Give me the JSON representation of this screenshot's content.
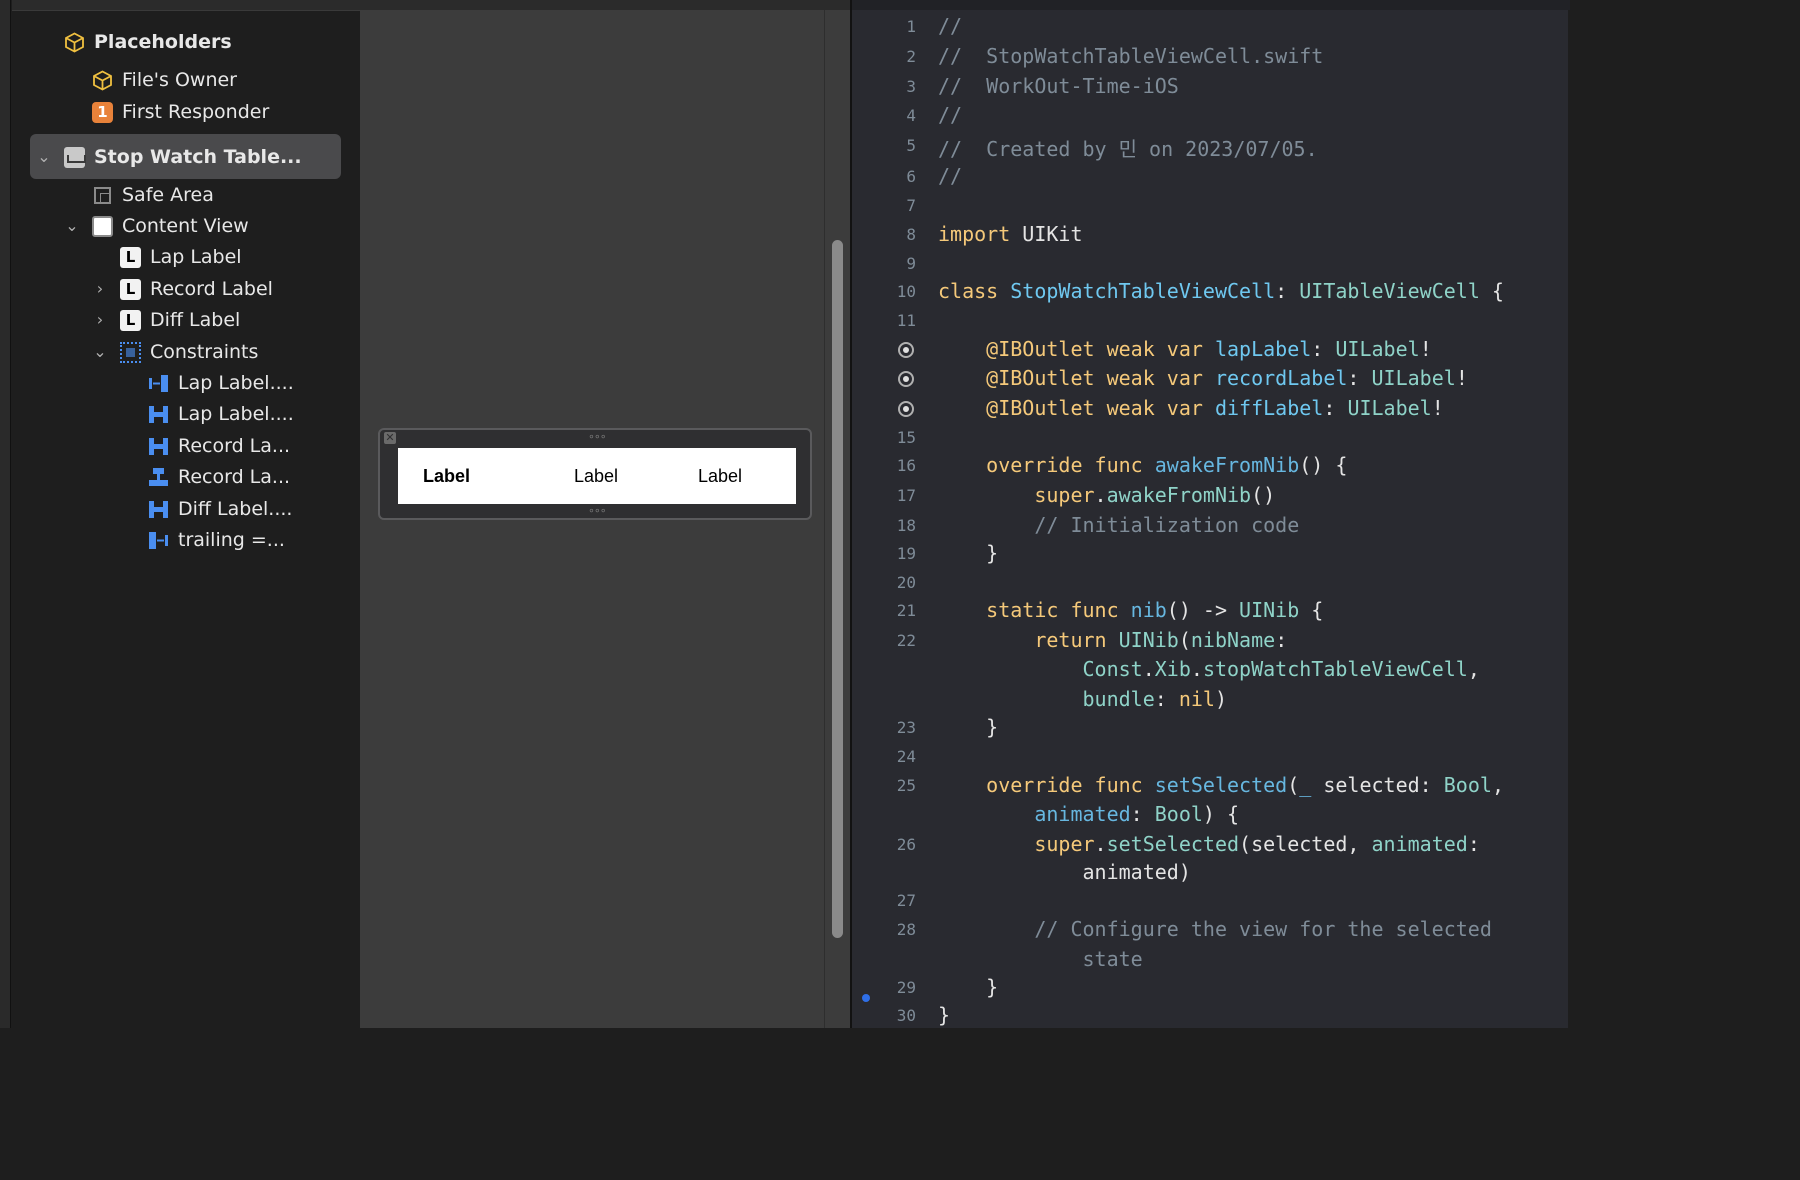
{
  "outline": {
    "placeholders": "Placeholders",
    "files_owner": "File's Owner",
    "first_responder_badge": "1",
    "first_responder": "First Responder",
    "cell": "Stop Watch Table...",
    "safe_area": "Safe Area",
    "content_view": "Content View",
    "lap_label": "Lap Label",
    "record_label": "Record Label",
    "diff_label": "Diff Label",
    "constraints": "Constraints",
    "constraint_items": [
      "Lap Label....",
      "Lap Label....",
      "Record La...",
      "Record La...",
      "Diff Label....",
      "trailing =..."
    ],
    "label_icon_letter": "L"
  },
  "canvas": {
    "labels": [
      "Label",
      "Label",
      "Label"
    ]
  },
  "editor": {
    "line_numbers": [
      "1",
      "2",
      "3",
      "4",
      "5",
      "6",
      "7",
      "8",
      "9",
      "10",
      "11",
      "",
      "",
      "",
      "15",
      "16",
      "17",
      "18",
      "19",
      "20",
      "21",
      "22",
      "",
      "",
      "23",
      "24",
      "25",
      "",
      "26",
      "",
      "27",
      "28",
      "",
      "29",
      "30"
    ],
    "lines": [
      {
        "n": "1",
        "parts": [
          {
            "t": "//",
            "c": "comment"
          }
        ]
      },
      {
        "n": "2",
        "parts": [
          {
            "t": "//  StopWatchTableViewCell.swift",
            "c": "comment"
          }
        ]
      },
      {
        "n": "3",
        "parts": [
          {
            "t": "//  WorkOut-Time-iOS",
            "c": "comment"
          }
        ]
      },
      {
        "n": "4",
        "parts": [
          {
            "t": "//",
            "c": "comment"
          }
        ]
      },
      {
        "n": "5",
        "parts": [
          {
            "t": "//  Created by 민 on 2023/07/05.",
            "c": "comment"
          }
        ]
      },
      {
        "n": "6",
        "parts": [
          {
            "t": "//",
            "c": "comment"
          }
        ]
      },
      {
        "n": "7",
        "parts": []
      },
      {
        "n": "8",
        "parts": [
          {
            "t": "import",
            "c": "kw"
          },
          {
            "t": " UIKit",
            "c": "plain"
          }
        ]
      },
      {
        "n": "9",
        "parts": []
      },
      {
        "n": "10",
        "parts": [
          {
            "t": "class",
            "c": "kw"
          },
          {
            "t": " ",
            "c": "plain"
          },
          {
            "t": "StopWatchTableViewCell",
            "c": "decl"
          },
          {
            "t": ": ",
            "c": "plain"
          },
          {
            "t": "UITableViewCell",
            "c": "type"
          },
          {
            "t": " {",
            "c": "plain"
          }
        ]
      },
      {
        "n": "11",
        "parts": []
      },
      {
        "n": "",
        "bp": true,
        "parts": [
          {
            "t": "    ",
            "c": "plain"
          },
          {
            "t": "@IBOutlet weak var",
            "c": "kw"
          },
          {
            "t": " ",
            "c": "plain"
          },
          {
            "t": "lapLabel",
            "c": "decl"
          },
          {
            "t": ": ",
            "c": "plain"
          },
          {
            "t": "UILabel",
            "c": "type"
          },
          {
            "t": "!",
            "c": "plain"
          }
        ]
      },
      {
        "n": "",
        "bp": true,
        "parts": [
          {
            "t": "    ",
            "c": "plain"
          },
          {
            "t": "@IBOutlet weak var",
            "c": "kw"
          },
          {
            "t": " ",
            "c": "plain"
          },
          {
            "t": "recordLabel",
            "c": "decl"
          },
          {
            "t": ": ",
            "c": "plain"
          },
          {
            "t": "UILabel",
            "c": "type"
          },
          {
            "t": "!",
            "c": "plain"
          }
        ]
      },
      {
        "n": "",
        "bp": true,
        "parts": [
          {
            "t": "    ",
            "c": "plain"
          },
          {
            "t": "@IBOutlet weak var",
            "c": "kw"
          },
          {
            "t": " ",
            "c": "plain"
          },
          {
            "t": "diffLabel",
            "c": "decl"
          },
          {
            "t": ": ",
            "c": "plain"
          },
          {
            "t": "UILabel",
            "c": "type"
          },
          {
            "t": "!",
            "c": "plain"
          }
        ]
      },
      {
        "n": "15",
        "parts": []
      },
      {
        "n": "16",
        "parts": [
          {
            "t": "    ",
            "c": "plain"
          },
          {
            "t": "override func",
            "c": "kw"
          },
          {
            "t": " ",
            "c": "plain"
          },
          {
            "t": "awakeFromNib",
            "c": "fn"
          },
          {
            "t": "() {",
            "c": "plain"
          }
        ]
      },
      {
        "n": "17",
        "parts": [
          {
            "t": "        ",
            "c": "plain"
          },
          {
            "t": "super",
            "c": "kw"
          },
          {
            "t": ".",
            "c": "plain"
          },
          {
            "t": "awakeFromNib",
            "c": "prop"
          },
          {
            "t": "()",
            "c": "plain"
          }
        ]
      },
      {
        "n": "18",
        "parts": [
          {
            "t": "        // Initialization code",
            "c": "comment"
          }
        ]
      },
      {
        "n": "19",
        "parts": [
          {
            "t": "    }",
            "c": "plain"
          }
        ]
      },
      {
        "n": "20",
        "parts": []
      },
      {
        "n": "21",
        "parts": [
          {
            "t": "    ",
            "c": "plain"
          },
          {
            "t": "static func",
            "c": "kw"
          },
          {
            "t": " ",
            "c": "plain"
          },
          {
            "t": "nib",
            "c": "fn"
          },
          {
            "t": "() -> ",
            "c": "plain"
          },
          {
            "t": "UINib",
            "c": "type"
          },
          {
            "t": " {",
            "c": "plain"
          }
        ]
      },
      {
        "n": "22",
        "parts": [
          {
            "t": "        ",
            "c": "plain"
          },
          {
            "t": "return",
            "c": "kw"
          },
          {
            "t": " ",
            "c": "plain"
          },
          {
            "t": "UINib",
            "c": "type"
          },
          {
            "t": "(",
            "c": "plain"
          },
          {
            "t": "nibName",
            "c": "prop"
          },
          {
            "t": ":",
            "c": "plain"
          }
        ]
      },
      {
        "n": "",
        "parts": [
          {
            "t": "            ",
            "c": "plain"
          },
          {
            "t": "Const",
            "c": "type"
          },
          {
            "t": ".",
            "c": "plain"
          },
          {
            "t": "Xib",
            "c": "type"
          },
          {
            "t": ".",
            "c": "plain"
          },
          {
            "t": "stopWatchTableViewCell",
            "c": "prop"
          },
          {
            "t": ",",
            "c": "plain"
          }
        ]
      },
      {
        "n": "",
        "parts": [
          {
            "t": "            ",
            "c": "plain"
          },
          {
            "t": "bundle",
            "c": "prop"
          },
          {
            "t": ": ",
            "c": "plain"
          },
          {
            "t": "nil",
            "c": "kw"
          },
          {
            "t": ")",
            "c": "plain"
          }
        ]
      },
      {
        "n": "23",
        "parts": [
          {
            "t": "    }",
            "c": "plain"
          }
        ]
      },
      {
        "n": "24",
        "parts": []
      },
      {
        "n": "25",
        "parts": [
          {
            "t": "    ",
            "c": "plain"
          },
          {
            "t": "override func",
            "c": "kw"
          },
          {
            "t": " ",
            "c": "plain"
          },
          {
            "t": "setSelected",
            "c": "fn"
          },
          {
            "t": "(",
            "c": "plain"
          },
          {
            "t": "_",
            "c": "fn"
          },
          {
            "t": " selected: ",
            "c": "plain"
          },
          {
            "t": "Bool",
            "c": "type"
          },
          {
            "t": ",",
            "c": "plain"
          }
        ]
      },
      {
        "n": "",
        "parts": [
          {
            "t": "        ",
            "c": "plain"
          },
          {
            "t": "animated",
            "c": "fn"
          },
          {
            "t": ": ",
            "c": "plain"
          },
          {
            "t": "Bool",
            "c": "type"
          },
          {
            "t": ") {",
            "c": "plain"
          }
        ]
      },
      {
        "n": "26",
        "parts": [
          {
            "t": "        ",
            "c": "plain"
          },
          {
            "t": "super",
            "c": "kw"
          },
          {
            "t": ".",
            "c": "plain"
          },
          {
            "t": "setSelected",
            "c": "prop"
          },
          {
            "t": "(selected, ",
            "c": "plain"
          },
          {
            "t": "animated",
            "c": "prop"
          },
          {
            "t": ":",
            "c": "plain"
          }
        ]
      },
      {
        "n": "",
        "parts": [
          {
            "t": "            animated)",
            "c": "plain"
          }
        ]
      },
      {
        "n": "27",
        "parts": []
      },
      {
        "n": "28",
        "parts": [
          {
            "t": "        // Configure the view for the selected",
            "c": "comment"
          }
        ]
      },
      {
        "n": "",
        "parts": [
          {
            "t": "            state",
            "c": "comment"
          }
        ]
      },
      {
        "n": "29",
        "dot": true,
        "parts": [
          {
            "t": "    }",
            "c": "plain"
          }
        ]
      },
      {
        "n": "30",
        "parts": [
          {
            "t": "}",
            "c": "plain"
          }
        ]
      }
    ]
  },
  "colors": {
    "comment": "#7f8c98",
    "keyword": "#f5c97a",
    "type": "#8fd3c8",
    "declaration": "#6fc8f0",
    "function": "#67b7e0",
    "plain": "#e4e4e4",
    "accent_blue": "#4a8ef0",
    "badge_orange": "#e8823a"
  }
}
